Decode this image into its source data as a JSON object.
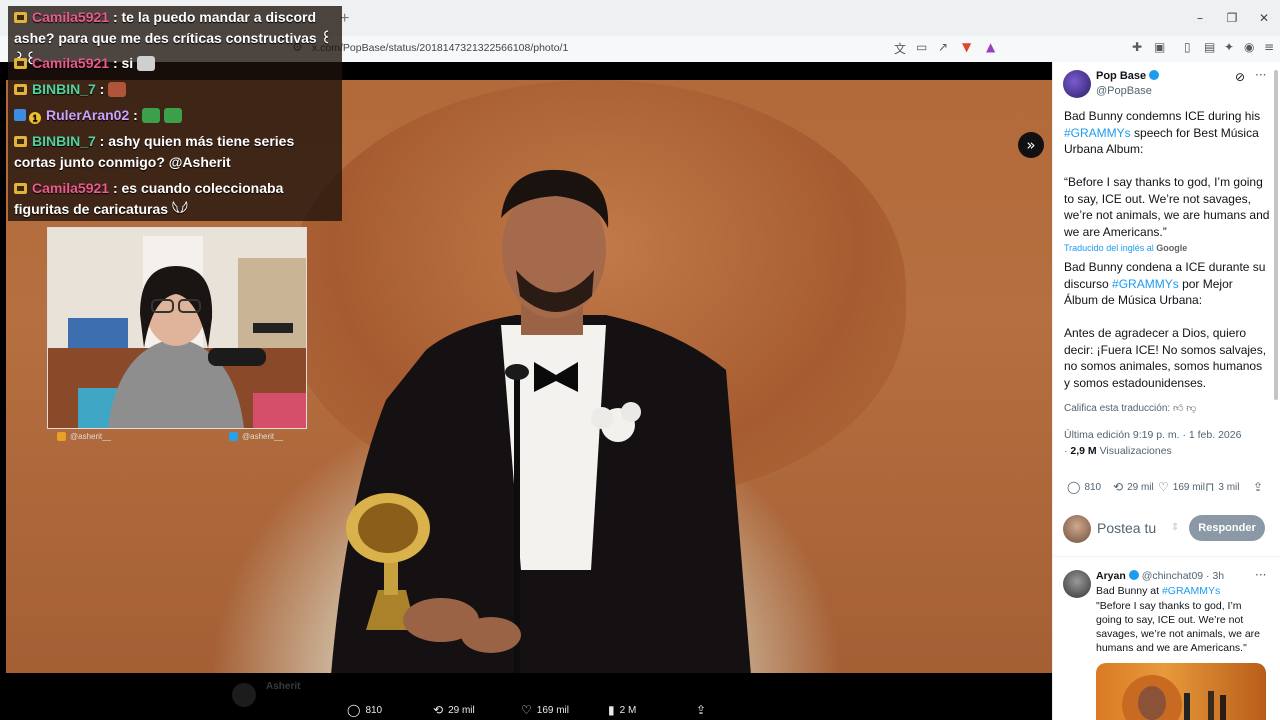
{
  "browser": {
    "url": "x.com/PopBase/status/2018147321322566108/photo/1",
    "new_tab": "+",
    "minimize": "–",
    "restore": "❐",
    "close": "✕"
  },
  "chat": {
    "messages": [
      {
        "user": "Camila5921",
        "user_color": "#e95a8f",
        "text": "te la puedo mandar a discord ashe? para que me des críticas constructivas ꒰꒱꒰"
      },
      {
        "user": "Camila5921",
        "user_color": "#e95a8f",
        "text": "si"
      },
      {
        "user": "BINBIN_7",
        "user_color": "#4fd1a0",
        "text": ""
      },
      {
        "user": "RulerAran02",
        "user_color": "#c9a2ff",
        "text": ""
      },
      {
        "user": "BINBIN_7",
        "user_color": "#4fd1a0",
        "text": "ashy quien más tiene series cortas junto conmigo? @Asherit"
      },
      {
        "user": "Camila5921",
        "user_color": "#e95a8f",
        "text": "es cuando coleccionaba figuritas de caricaturas 𓆩𓆪"
      }
    ]
  },
  "webcam": {
    "handle_instagram": "@asherit__",
    "handle_twitter": "@asherit__"
  },
  "viewer": {
    "faded_author": "Asherit",
    "actions": {
      "replies": "810",
      "reposts": "29 mil",
      "likes": "169 mil",
      "views": "2 M"
    }
  },
  "tweet": {
    "name": "Pop Base",
    "handle": "@PopBase",
    "text_en_1": "Bad Bunny condemns ICE during his",
    "hashtag": "#GRAMMYs",
    "text_en_2": "speech for Best Música Urbana Album:",
    "quote_en": "“Before I say thanks to god, I’m going to say, ICE out. We’re not savages, we’re not animals, we are humans and we are Americans.”",
    "translated_from": "Traducido del inglés al",
    "google": "Google",
    "text_es_1": "Bad Bunny condena a ICE durante su discurso",
    "text_es_2": "por Mejor Álbum de Música Urbana:",
    "quote_es": "Antes de agradecer a Dios, quiero decir: ¡Fuera ICE! No somos salvajes, no somos animales, somos humanos y somos estadounidenses.",
    "rate_translation": "Califica esta traducción:",
    "edited": "Última edición 9:19 p. m. · 1 feb. 2026",
    "views_count": "2,9 M",
    "views_label": "Visualizaciones",
    "stats": {
      "replies": "810",
      "reposts": "29 mil",
      "likes": "169 mil",
      "bookmarks": "3 mil"
    },
    "reply_placeholder": "Postea tu",
    "reply_button": "Responder"
  },
  "reply": {
    "name": "Aryan",
    "handle_time": "@chinchat09 · 3h",
    "text_1": "Bad Bunny at",
    "hashtag": "#GRAMMYs",
    "quote": "\"Before I say thanks to god, I’m going to say, ICE out. We’re not savages, we’re not animals, we are humans and we are Americans.\""
  },
  "colors": {
    "twitter_blue": "#1d9bf0",
    "reply_button": "#8b98a5"
  }
}
